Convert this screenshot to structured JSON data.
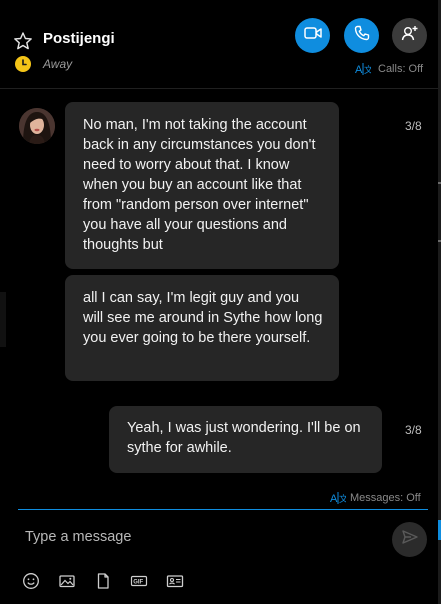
{
  "header": {
    "contact_name": "Postijengi",
    "status": "Away",
    "calls_label": "Calls: Off",
    "icons": {
      "favorite": "star-icon",
      "away": "clock-icon",
      "video": "video-camera-icon",
      "call": "phone-icon",
      "add": "add-person-icon",
      "translate": "translate-icon"
    }
  },
  "conversation": {
    "messages": [
      {
        "sender": "contact",
        "text": "No man, I'm not taking the account back in any circumstances you don't need to worry about that. I know when you buy an account like that from \"random person over internet\" you have all your questions and thoughts but",
        "counter": "3/8"
      },
      {
        "sender": "contact",
        "text": "all I can say, I'm legit guy and you will see me around in Sythe how long you ever going to be there yourself."
      },
      {
        "sender": "me",
        "text": "Yeah, I was just wondering. I'll be on sythe for awhile.",
        "counter": "3/8"
      }
    ],
    "messages_translation_label": "Messages: Off"
  },
  "composer": {
    "placeholder": "Type a message",
    "tools": [
      "emoji-icon",
      "image-icon",
      "file-icon",
      "gif-icon",
      "contact-card-icon"
    ],
    "send_icon": "send-icon"
  },
  "colors": {
    "accent": "#0f8ddf",
    "background": "#000000",
    "bubble": "#262626",
    "away": "#f5c518"
  }
}
